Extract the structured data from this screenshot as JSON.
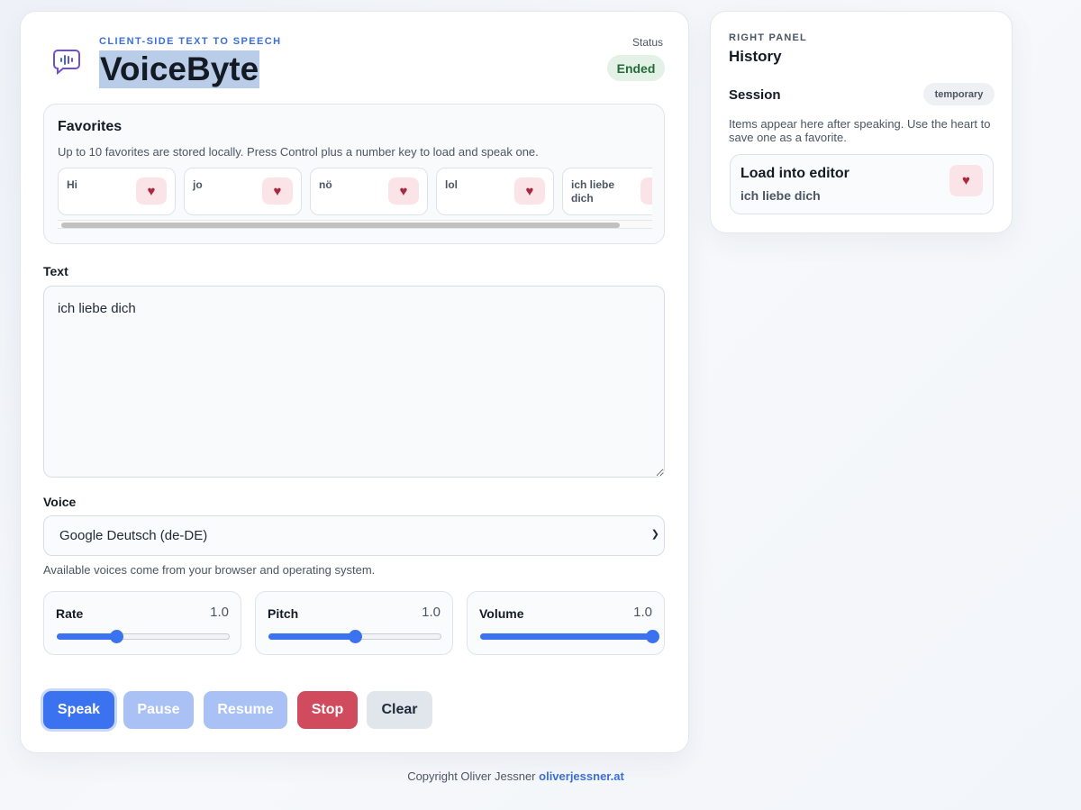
{
  "header": {
    "kicker": "CLIENT-SIDE TEXT TO SPEECH",
    "title": "VoiceByte",
    "status_label": "Status",
    "status_value": "Ended",
    "logo_icon": "speech-bubble-waveform-icon"
  },
  "favorites": {
    "title": "Favorites",
    "description": "Up to 10 favorites are stored locally. Press Control plus a number key to load and speak one.",
    "items": [
      {
        "text": "Hi"
      },
      {
        "text": "jo"
      },
      {
        "text": "nö"
      },
      {
        "text": "lol"
      },
      {
        "text": "ich liebe dich"
      }
    ],
    "heart_icon": "heart-icon"
  },
  "text_field": {
    "label": "Text",
    "value": "ich liebe dich"
  },
  "voice": {
    "label": "Voice",
    "selected": "Google Deutsch (de-DE)",
    "hint": "Available voices come from your browser and operating system."
  },
  "sliders": {
    "rate": {
      "label": "Rate",
      "value": "1.0",
      "fraction": 0.34
    },
    "pitch": {
      "label": "Pitch",
      "value": "1.0",
      "fraction": 0.5
    },
    "volume": {
      "label": "Volume",
      "value": "1.0",
      "fraction": 1.0
    }
  },
  "buttons": {
    "speak": "Speak",
    "pause": "Pause",
    "resume": "Resume",
    "stop": "Stop",
    "clear": "Clear"
  },
  "footer": {
    "text": "Copyright Oliver Jessner",
    "link": "oliverjessner.at"
  },
  "right_panel": {
    "kicker": "RIGHT PANEL",
    "title": "History",
    "session_label": "Session",
    "session_badge": "temporary",
    "description": "Items appear here after speaking. Use the heart to save one as a favorite.",
    "items": [
      {
        "title": "Load into editor",
        "text": "ich liebe dich"
      }
    ]
  },
  "colors": {
    "accent": "#3b72f0",
    "stop": "#cf4b5d",
    "status_bg": "#e3f1e6",
    "status_text": "#256b3a",
    "heart": "#a8283f"
  }
}
